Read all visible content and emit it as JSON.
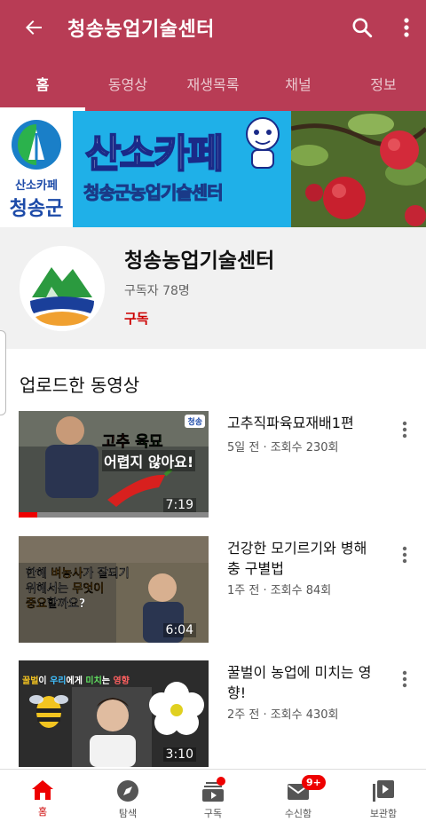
{
  "header": {
    "title": "청송농업기술센터",
    "tabs": [
      {
        "label": "홈",
        "active": true
      },
      {
        "label": "동영상",
        "active": false
      },
      {
        "label": "재생목록",
        "active": false
      },
      {
        "label": "채널",
        "active": false
      },
      {
        "label": "정보",
        "active": false
      }
    ],
    "icons": [
      "back-arrow-icon",
      "search-icon",
      "more-vertical-icon"
    ],
    "accent_color": "#b83c55"
  },
  "banner": {
    "logo_top": "산소카페",
    "logo_bottom": "청송군",
    "cafe_text": "산소카페",
    "center_text": "청송군농업기술센터"
  },
  "channel": {
    "name": "청송농업기술센터",
    "subscribers": "구독자 78명",
    "subscribe_label": "구독"
  },
  "section": {
    "title": "업로드한 동영상"
  },
  "videos": [
    {
      "title": "고추직파육묘재배1편",
      "meta": "5일 전 · 조회수 230회",
      "duration": "7:19",
      "thumb_badge": "청송",
      "thumb_line1a": "고추",
      "thumb_line1b": "육묘",
      "thumb_line2": "어렵지 않아요!",
      "watched_fraction": 0.1
    },
    {
      "title": "건강한 모기르기와 병해충 구별법",
      "meta": "1주 전 · 조회수 84회",
      "duration": "6:04",
      "thumb_l1a": "한해 ",
      "thumb_l1b": "벼농사",
      "thumb_l1c": "가 잘되기",
      "thumb_l2a": "위해서는 ",
      "thumb_l2b": "무엇이",
      "thumb_l3a": "중요",
      "thumb_l3b": "할까요?"
    },
    {
      "title": "꿀벌이 농업에 미치는 영향!",
      "meta": "2주 전 · 조회수 430회",
      "duration": "3:10",
      "thumb_a": "꿀벌",
      "thumb_b": "이 ",
      "thumb_c": "우리",
      "thumb_d": "에게 ",
      "thumb_e": "미치",
      "thumb_f": "는 ",
      "thumb_g": "영향"
    }
  ],
  "bottom_nav": [
    {
      "label": "홈",
      "icon": "home-icon",
      "active": true
    },
    {
      "label": "탐색",
      "icon": "compass-icon",
      "active": false
    },
    {
      "label": "구독",
      "icon": "subscriptions-icon",
      "active": false
    },
    {
      "label": "수신함",
      "icon": "inbox-icon",
      "active": false,
      "badge": "9+"
    },
    {
      "label": "보관함",
      "icon": "library-icon",
      "active": false
    }
  ]
}
